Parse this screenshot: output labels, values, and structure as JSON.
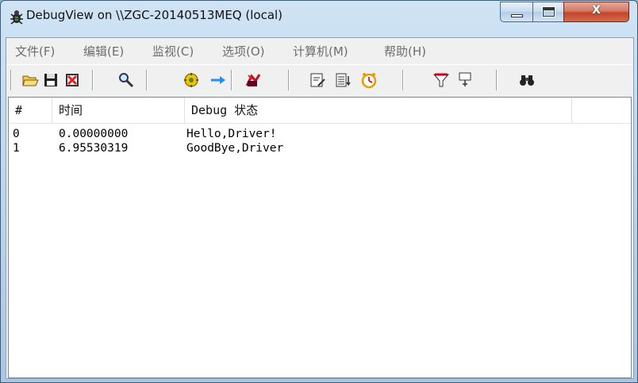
{
  "window": {
    "title": "DebugView on \\\\ZGC-20140513MEQ (local)",
    "caption_buttons": {
      "minimize": "minimize-icon",
      "maximize": "maximize-icon",
      "close": "X"
    }
  },
  "menu": [
    "文件(F)",
    "编辑(E)",
    "监视(C)",
    "选项(O)",
    "计算机(M)",
    "帮助(H)"
  ],
  "toolbar_icons": [
    "open-folder-icon",
    "save-icon",
    "clear-icon",
    "find-icon",
    "capture-icon",
    "autoscroll-icon",
    "capture-kernel-icon",
    "edit-filter-icon",
    "history-icon",
    "clock-time-icon",
    "filter-icon",
    "highlight-icon",
    "binoculars-icon"
  ],
  "table": {
    "columns": [
      "#",
      "时间",
      "Debug 状态"
    ],
    "rows": [
      {
        "num": "0",
        "time": "0.00000000",
        "message": "Hello,Driver!"
      },
      {
        "num": "1",
        "time": "6.95530319",
        "message": "GoodBye,Driver"
      }
    ]
  },
  "colors": {
    "title_gradient": "#b9d3ea",
    "close_button": "#c2452c",
    "client_bg": "#f0f0f0"
  }
}
